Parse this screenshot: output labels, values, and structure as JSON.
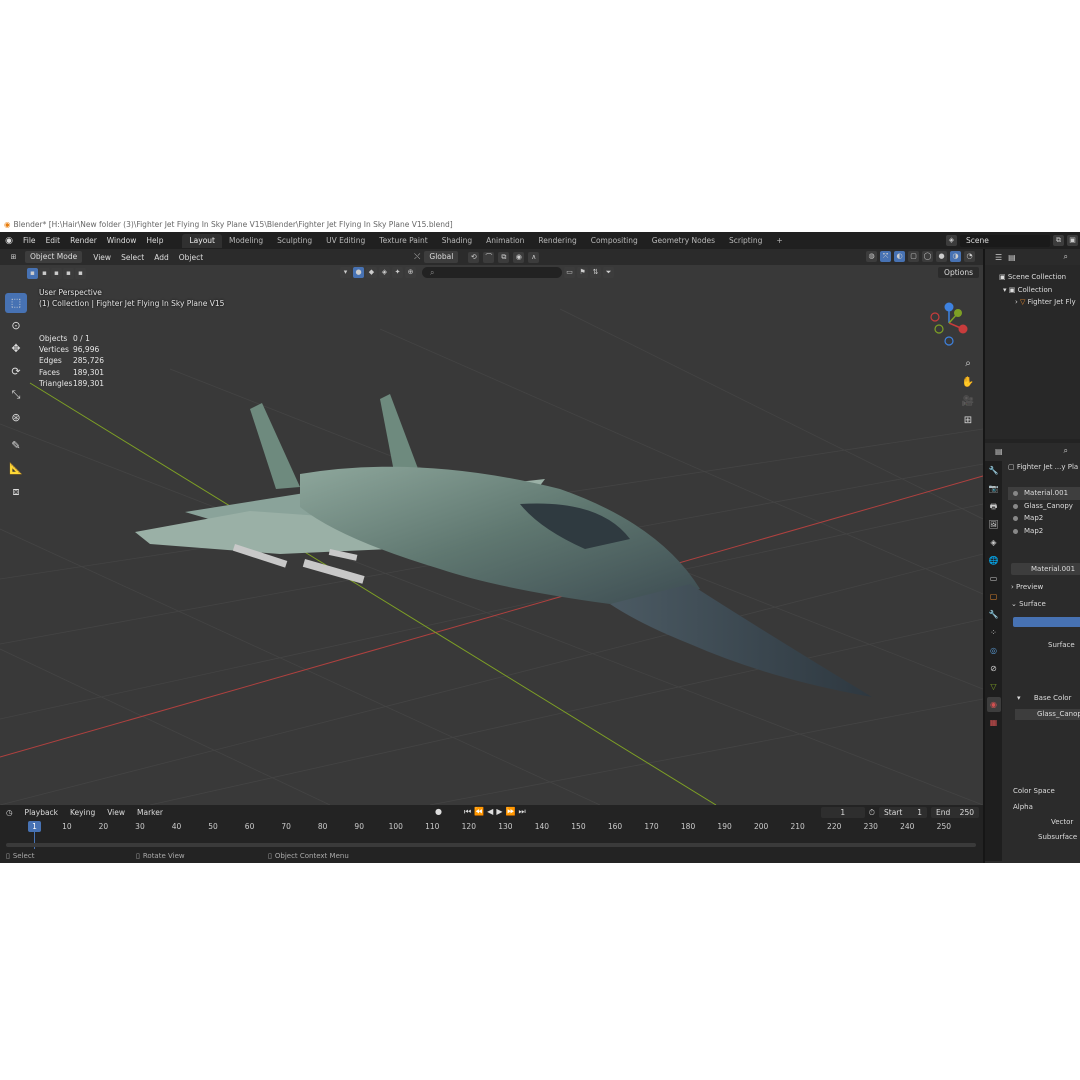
{
  "window": {
    "title": "Blender* [H:\\Hair\\New folder (3)\\Fighter Jet Flying In Sky Plane V15\\Blender\\Fighter Jet Flying In Sky Plane V15.blend]"
  },
  "menu": [
    "File",
    "Edit",
    "Render",
    "Window",
    "Help"
  ],
  "workspaces": [
    "Layout",
    "Modeling",
    "Sculpting",
    "UV Editing",
    "Texture Paint",
    "Shading",
    "Animation",
    "Rendering",
    "Compositing",
    "Geometry Nodes",
    "Scripting",
    "+"
  ],
  "scene_name": "Scene",
  "viewport": {
    "mode": "Object Mode",
    "menus": [
      "View",
      "Select",
      "Add",
      "Object"
    ],
    "transform": "Global",
    "options_label": "Options",
    "perspective": "User Perspective",
    "collection_line": "(1) Collection | Fighter Jet Flying In Sky Plane V15",
    "stats": [
      {
        "label": "Objects",
        "value": "0 / 1"
      },
      {
        "label": "Vertices",
        "value": "96,996"
      },
      {
        "label": "Edges",
        "value": "285,726"
      },
      {
        "label": "Faces",
        "value": "189,301"
      },
      {
        "label": "Triangles",
        "value": "189,301"
      }
    ]
  },
  "timeline": {
    "menus": [
      "Playback",
      "Keying",
      "View",
      "Marker"
    ],
    "current_frame": "1",
    "start_label": "Start",
    "start": "1",
    "end_label": "End",
    "end": "250",
    "ticks": [
      "1",
      "10",
      "20",
      "30",
      "40",
      "50",
      "60",
      "70",
      "80",
      "90",
      "100",
      "110",
      "120",
      "130",
      "140",
      "150",
      "160",
      "170",
      "180",
      "190",
      "200",
      "210",
      "220",
      "230",
      "240",
      "250"
    ]
  },
  "status": {
    "select": "Select",
    "rotate": "Rotate View",
    "context": "Object Context Menu"
  },
  "outliner": {
    "scene_collection": "Scene Collection",
    "collection": "Collection",
    "object": "Fighter Jet Fly"
  },
  "properties": {
    "object_name": "Fighter Jet ...y Pla",
    "slots": [
      "Material.001",
      "Glass_Canopy",
      "Map2",
      "Map2"
    ],
    "material": "Material.001",
    "preview": "Preview",
    "surface_panel": "Surface",
    "surface_label": "Surface",
    "base_color": "Base Color",
    "texture": "Glass_Canopy",
    "color_space": "Color Space",
    "alpha": "Alpha",
    "vector": "Vector",
    "subsurface": "Subsurface"
  },
  "colors": {
    "accent": "#4772b3",
    "x_axis": "#c83c3c",
    "y_axis": "#7ea025",
    "z_axis": "#3e82e0"
  }
}
